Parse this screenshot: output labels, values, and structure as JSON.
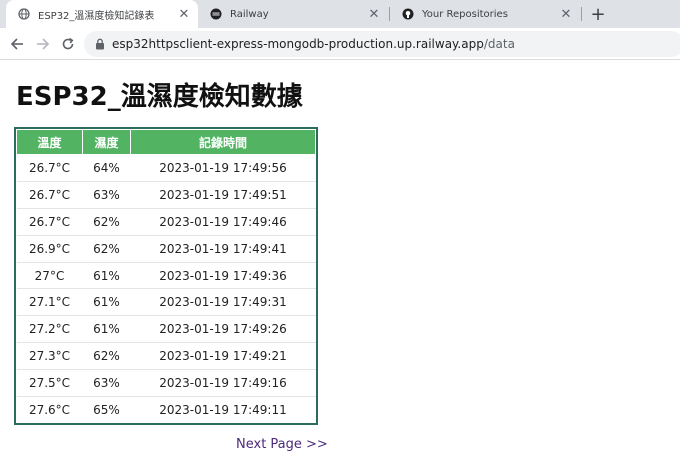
{
  "browser": {
    "tabs": [
      {
        "title": "ESP32_溫濕度檢知記錄表",
        "icon": "globe-icon",
        "active": true
      },
      {
        "title": "Railway",
        "icon": "railway-icon",
        "active": false
      },
      {
        "title": "Your Repositories",
        "icon": "github-icon",
        "active": false
      }
    ],
    "address": {
      "host": "esp32httpsclient-express-mongodb-production.up.railway.app",
      "path": "/data"
    }
  },
  "page": {
    "title": "ESP32_溫濕度檢知數據",
    "table": {
      "headers": [
        "溫度",
        "濕度",
        "記錄時間"
      ],
      "rows": [
        [
          "26.7°C",
          "64%",
          "2023-01-19 17:49:56"
        ],
        [
          "26.7°C",
          "63%",
          "2023-01-19 17:49:51"
        ],
        [
          "26.7°C",
          "62%",
          "2023-01-19 17:49:46"
        ],
        [
          "26.9°C",
          "62%",
          "2023-01-19 17:49:41"
        ],
        [
          "27°C",
          "61%",
          "2023-01-19 17:49:36"
        ],
        [
          "27.1°C",
          "61%",
          "2023-01-19 17:49:31"
        ],
        [
          "27.2°C",
          "61%",
          "2023-01-19 17:49:26"
        ],
        [
          "27.3°C",
          "62%",
          "2023-01-19 17:49:21"
        ],
        [
          "27.5°C",
          "63%",
          "2023-01-19 17:49:16"
        ],
        [
          "27.6°C",
          "65%",
          "2023-01-19 17:49:11"
        ]
      ]
    },
    "next_link": "Next Page >>"
  },
  "colors": {
    "header_bg": "#52b463",
    "table_border": "#2e6b5f",
    "link": "#4b2a7b"
  }
}
